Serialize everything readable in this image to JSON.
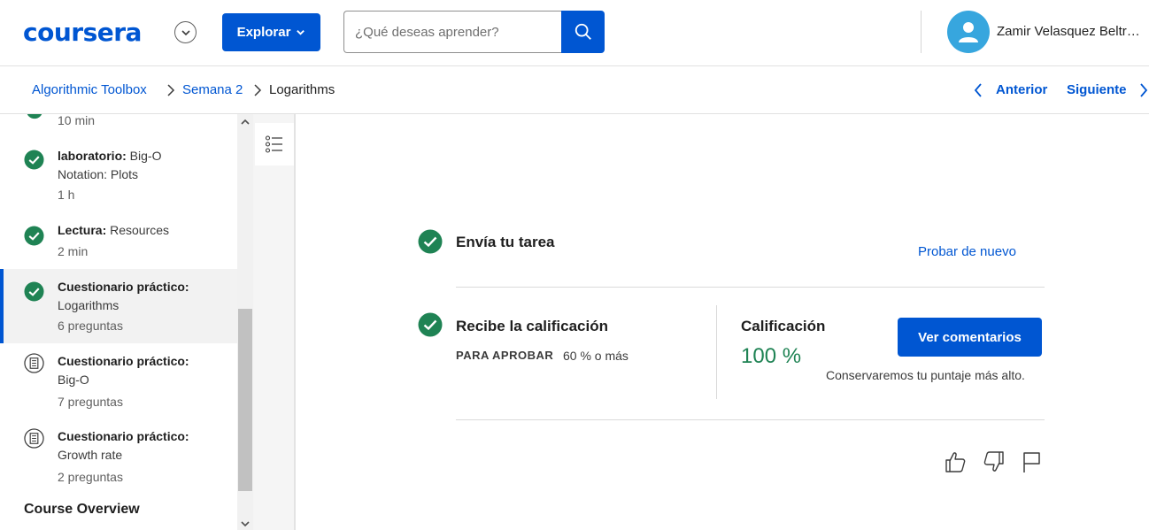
{
  "header": {
    "logo_text": "coursera",
    "explore_label": "Explorar",
    "search_placeholder": "¿Qué deseas aprender?",
    "user_name": "Zamir Velasquez Beltr…"
  },
  "breadcrumb": {
    "items": [
      "Algorithmic Toolbox",
      "Semana 2",
      "Logarithms"
    ],
    "prev_label": "Anterior",
    "next_label": "Siguiente"
  },
  "sidebar": {
    "top_partial_meta": "10 min",
    "items": [
      {
        "type": "laboratorio:",
        "title": " Big-O",
        "title2": "Notation: Plots",
        "meta": "1 h",
        "status": "completed"
      },
      {
        "type": "Lectura:",
        "title": " Resources",
        "title2": "",
        "meta": "2 min",
        "status": "completed"
      },
      {
        "type": "Cuestionario práctico:",
        "title": "",
        "title2": "Logarithms",
        "meta": "6 preguntas",
        "status": "completed"
      },
      {
        "type": "Cuestionario práctico:",
        "title": "",
        "title2": "Big-O",
        "meta": "7 preguntas",
        "status": "pending"
      },
      {
        "type": "Cuestionario práctico:",
        "title": "",
        "title2": "Growth rate",
        "meta": "2 preguntas",
        "status": "pending"
      }
    ],
    "section_title": "Course Overview"
  },
  "main": {
    "step1_title": "Envía tu tarea",
    "retry_label": "Probar de nuevo",
    "step2_title": "Recibe la calificación",
    "pass_label": "PARA APROBAR",
    "pass_value": "60 % o más",
    "grade_label": "Calificación",
    "grade_value": "100 %",
    "feedback_label": "Ver comentarios",
    "keep_note": "Conservaremos tu puntaje más alto."
  },
  "colors": {
    "brand": "#0056d2",
    "success": "#1f8354"
  }
}
